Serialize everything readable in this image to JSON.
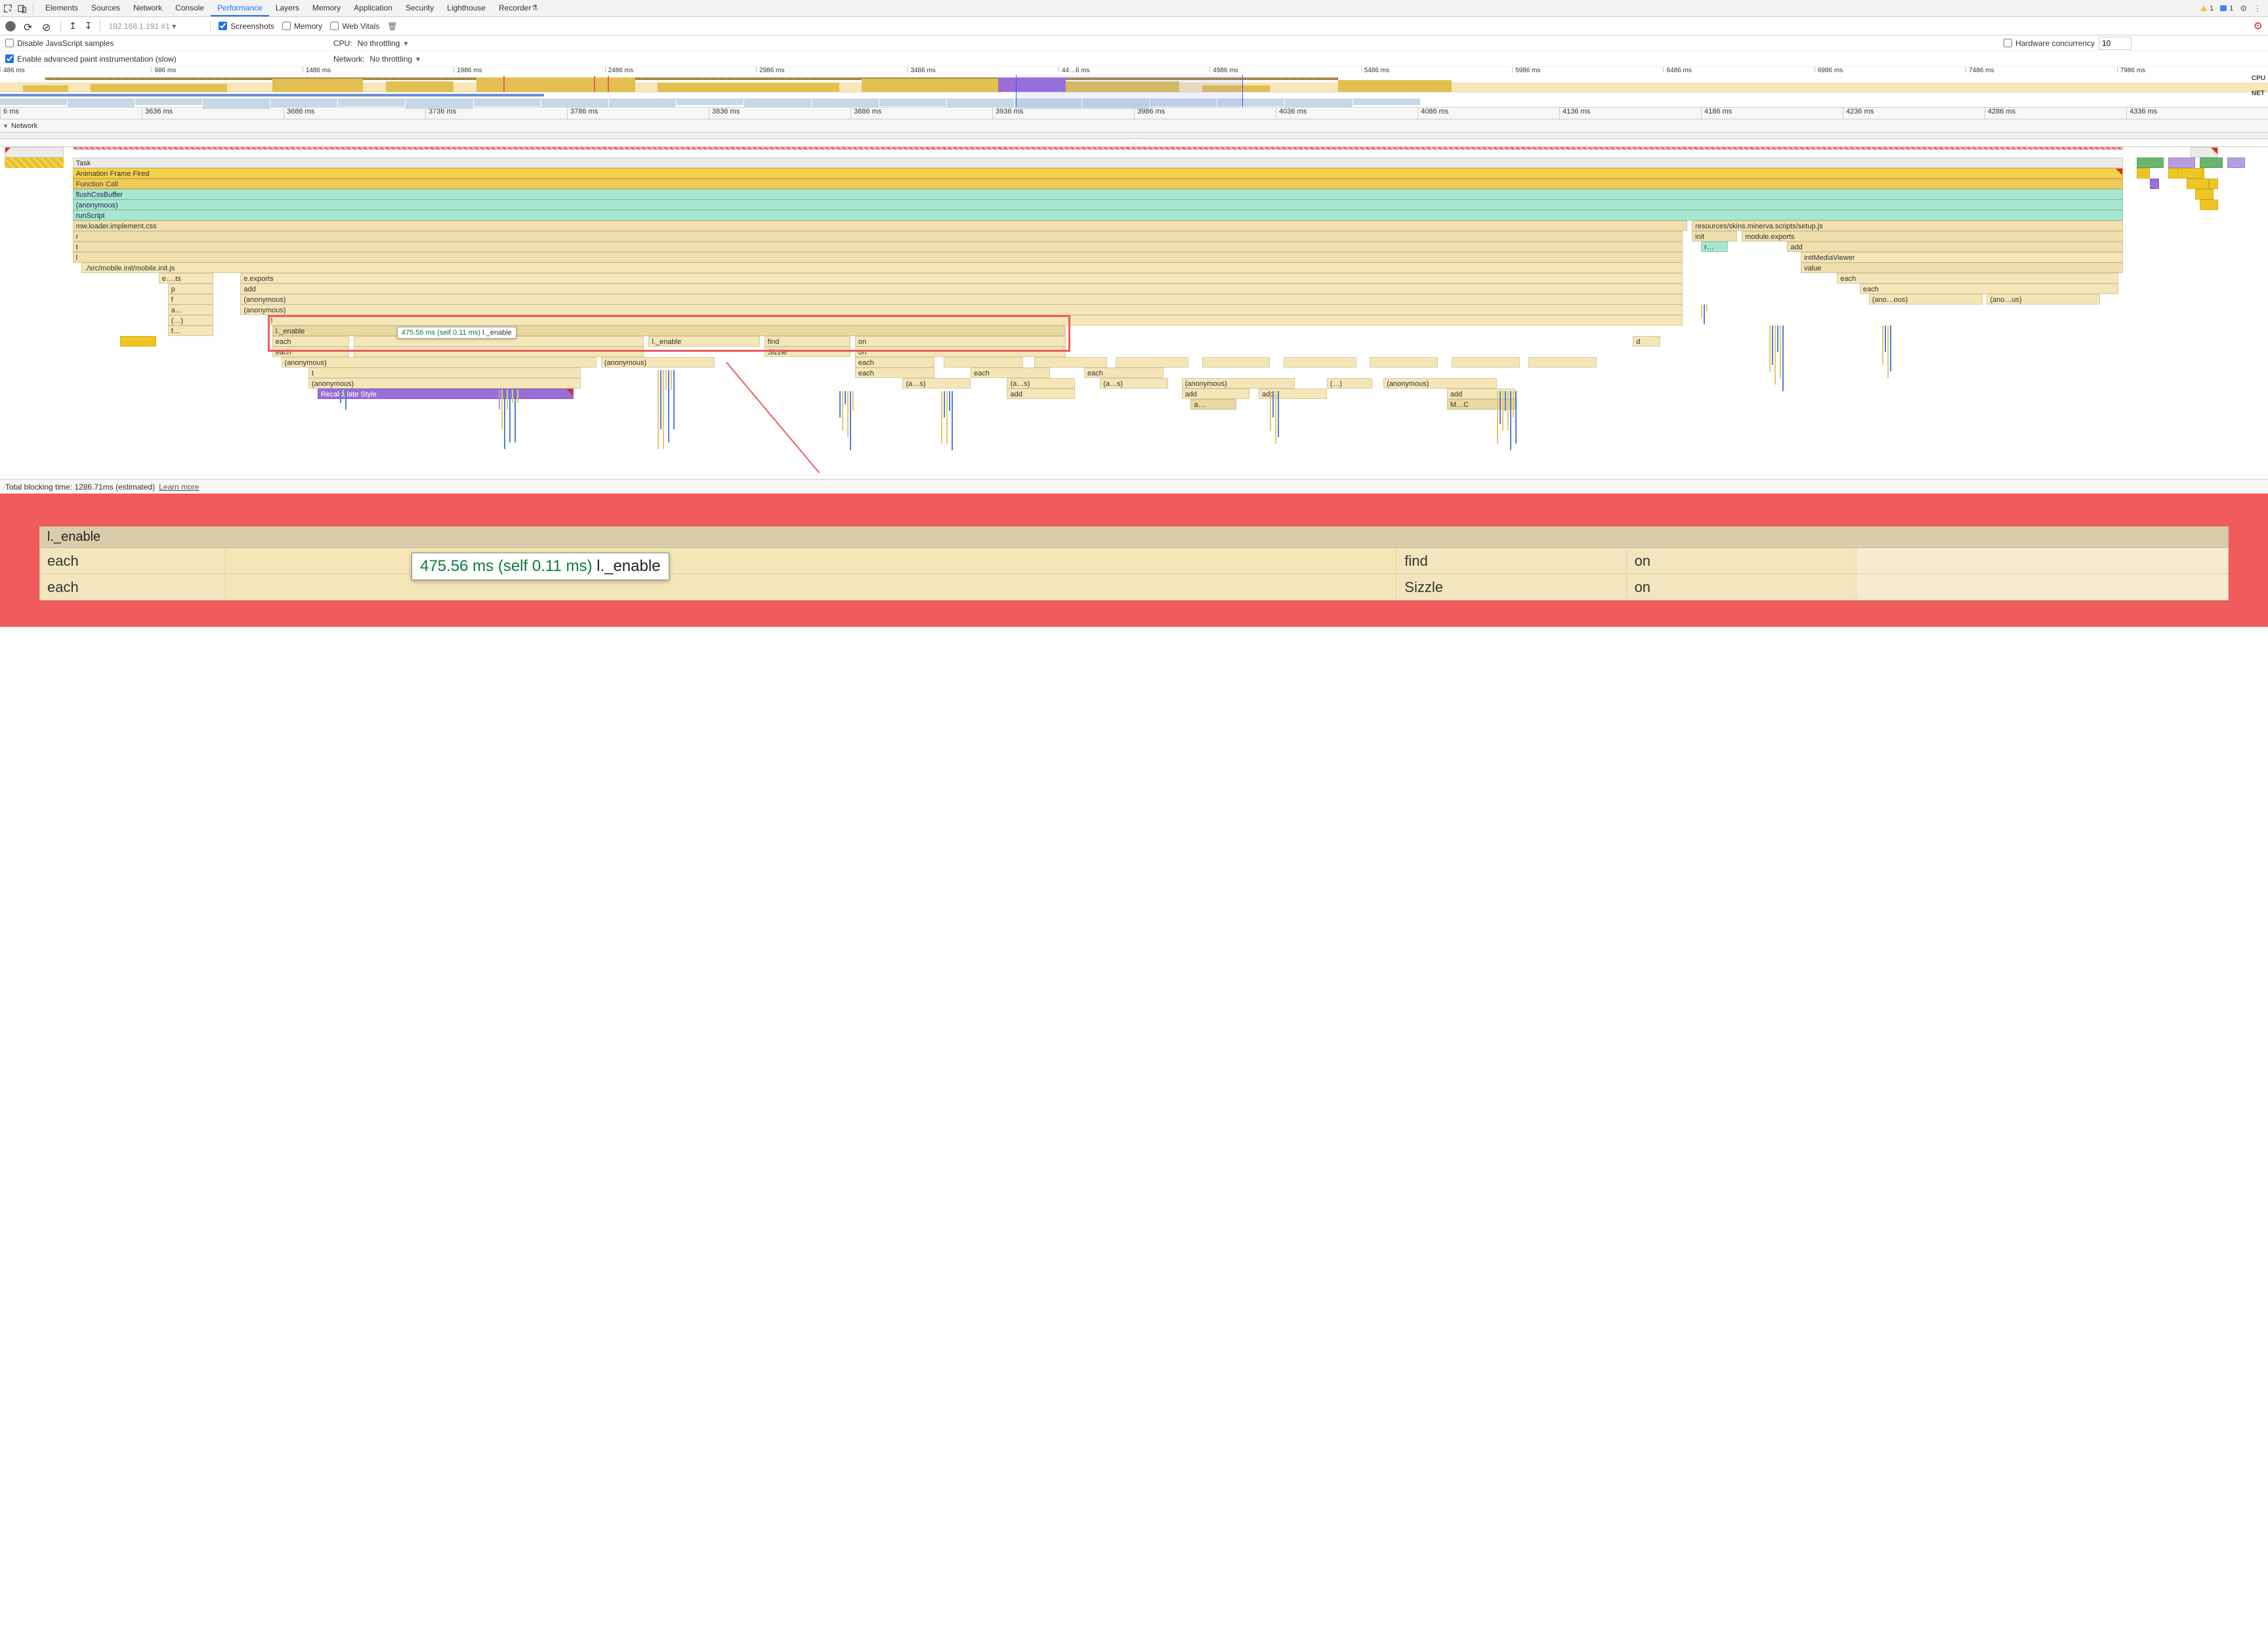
{
  "tabs": [
    "Elements",
    "Sources",
    "Network",
    "Console",
    "Performance",
    "Layers",
    "Memory",
    "Application",
    "Security",
    "Lighthouse",
    "Recorder"
  ],
  "activeTab": "Performance",
  "badges": {
    "warnings": "1",
    "messages": "1"
  },
  "toolbar": {
    "address": "192.168.1.191 #1",
    "screenshots": "Screenshots",
    "memory": "Memory",
    "webvitals": "Web Vitals"
  },
  "settings": {
    "disableJs": "Disable JavaScript samples",
    "cpuLabel": "CPU:",
    "cpuValue": "No throttling",
    "hwLabel": "Hardware concurrency",
    "hwValue": "10",
    "advPaint": "Enable advanced paint instrumentation (slow)",
    "netLabel": "Network:",
    "netValue": "No throttling"
  },
  "overview": {
    "ticks": [
      "486 ms",
      "986 ms",
      "1486 ms",
      "1986 ms",
      "2486 ms",
      "2986 ms",
      "3486 ms",
      "44…6 ms",
      "4986 ms",
      "5486 ms",
      "5986 ms",
      "6486 ms",
      "6986 ms",
      "7486 ms",
      "7986 ms"
    ],
    "rightLabels": [
      "CPU",
      "NET"
    ]
  },
  "ruler": [
    "6 ms",
    "3636 ms",
    "3686 ms",
    "3736 ms",
    "3786 ms",
    "3836 ms",
    "3886 ms",
    "3936 ms",
    "3986 ms",
    "4036 ms",
    "4086 ms",
    "4136 ms",
    "4186 ms",
    "4236 ms",
    "4286 ms",
    "4336 ms"
  ],
  "networkLabel": "Network",
  "ellipsis": "…",
  "flame": {
    "task": "Task",
    "aff": "Animation Frame Fired",
    "fncall": "Function Call",
    "flushCss": "flushCssBuffer",
    "anon": "(anonymous)",
    "runScript": "runScript",
    "mwloader": "mw.loader.implement.css",
    "resourcesSetup": "resources/skins.minerva.scripts/setup.js",
    "r": "r",
    "t": "t",
    "l": "l",
    "init": "init",
    "me": "module.exports",
    "rdots": "r…",
    "add": "add",
    "imv": "initMediaViewer",
    "value": "value",
    "each": "each",
    "anoous": "(ano…ous)",
    "anous": "(ano…us)",
    "srcinit": "./src/mobile.init/mobile.init.js",
    "eets": "e….ts",
    "eexp": "e.exports",
    "p": "p",
    "f": "f",
    "adots": "a…",
    "pardots": "(…)",
    "fdots": "f…",
    "lenable": "l._enable",
    "find": "find",
    "on": "on",
    "sizzle": "Sizzle",
    "d": "d",
    "recalc": "Recalculate Style",
    "as": "(a…s)",
    "mc": "M…C"
  },
  "tooltip": {
    "time": "475.56 ms",
    "self": "(self 0.11 ms)",
    "name": "l._enable"
  },
  "bottomBar": {
    "text": "Total blocking time: 1286.71ms (estimated)",
    "link": "Learn more"
  },
  "zoom": {
    "header": "l._enable",
    "r1": [
      "each",
      "",
      "find",
      "on",
      ""
    ],
    "r2": [
      "each",
      "",
      "Sizzle",
      "on",
      ""
    ],
    "tip": {
      "time": "475.56 ms (self 0.11 ms)",
      "name": "l._enable"
    }
  }
}
